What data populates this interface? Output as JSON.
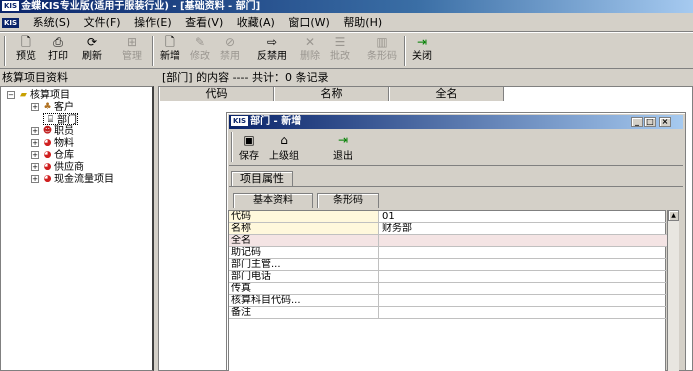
{
  "app": {
    "logo_text": "KIS",
    "title": "金蝶KIS专业版(适用于服装行业) - [基础资料 - 部门]"
  },
  "menu": [
    "系统(S)",
    "文件(F)",
    "操作(E)",
    "查看(V)",
    "收藏(A)",
    "窗口(W)",
    "帮助(H)"
  ],
  "toolbar": [
    {
      "label": "预览",
      "icon": "preview-icon",
      "enabled": true
    },
    {
      "label": "打印",
      "icon": "print-icon",
      "enabled": true
    },
    {
      "label": "刷新",
      "icon": "refresh-icon",
      "enabled": true
    },
    {
      "label": "管理",
      "icon": "manage-icon",
      "enabled": false
    },
    {
      "label": "新增",
      "icon": "new-icon",
      "enabled": true
    },
    {
      "label": "修改",
      "icon": "edit-icon",
      "enabled": false
    },
    {
      "label": "禁用",
      "icon": "disable-icon",
      "enabled": false
    },
    {
      "label": "反禁用",
      "icon": "enable-icon",
      "enabled": true
    },
    {
      "label": "删除",
      "icon": "delete-icon",
      "enabled": false
    },
    {
      "label": "批改",
      "icon": "batch-edit-icon",
      "enabled": false
    },
    {
      "label": "条形码",
      "icon": "barcode-icon",
      "enabled": false
    },
    {
      "label": "关闭",
      "icon": "close-door-icon",
      "enabled": true
    }
  ],
  "left_panel": {
    "header": "核算项目资料",
    "root": "核算项目",
    "items": [
      "客户",
      "部门",
      "职员",
      "物料",
      "仓库",
      "供应商",
      "现金流量项目"
    ]
  },
  "right_panel": {
    "header": "[部门] 的内容 ---- 共计：0 条记录",
    "columns": [
      "代码",
      "名称",
      "全名"
    ]
  },
  "dialog": {
    "logo_text": "KIS",
    "title": "部门 - 新增",
    "tools": [
      {
        "label": "保存",
        "icon": "save-icon"
      },
      {
        "label": "上级组",
        "icon": "parent-group-icon"
      },
      {
        "label": "退出",
        "icon": "exit-icon"
      }
    ],
    "outer_tab": "项目属性",
    "tabs": [
      "基本资料",
      "条形码"
    ],
    "fields": [
      {
        "key": "代码",
        "value": "01"
      },
      {
        "key": "名称",
        "value": "财务部"
      },
      {
        "key": "全名",
        "value": ""
      },
      {
        "key": "助记码",
        "value": ""
      },
      {
        "key": "部门主管...",
        "value": ""
      },
      {
        "key": "部门电话",
        "value": ""
      },
      {
        "key": "传真",
        "value": ""
      },
      {
        "key": "核算科目代码...",
        "value": ""
      },
      {
        "key": "备注",
        "value": ""
      }
    ]
  },
  "colors": {
    "title_bar": "#0a246a",
    "window_bg": "#d4d0c8",
    "required_field_bg": "#fff8dc",
    "highlight_field_bg": "#f4e4e4"
  }
}
